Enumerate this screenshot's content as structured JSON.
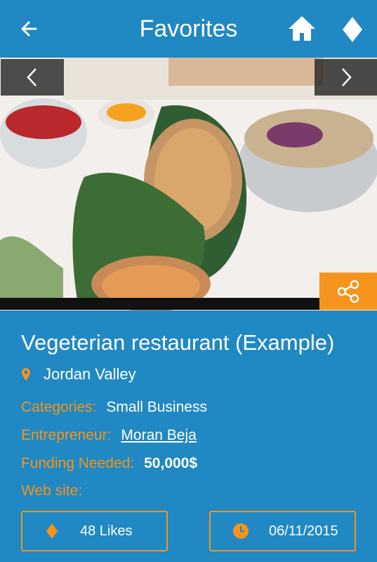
{
  "header": {
    "title": "Favorites"
  },
  "icons": {
    "back": "arrow-left-icon",
    "home": "home-icon",
    "favorite": "diamond-icon",
    "prev": "chevron-left-icon",
    "next": "chevron-right-icon",
    "share": "share-icon",
    "location": "location-pin-icon",
    "likes": "diamond-icon",
    "date": "clock-icon"
  },
  "colors": {
    "background": "#2088c2",
    "accent": "#f6941d",
    "text": "#ffffff"
  },
  "listing": {
    "name": "Vegeterian restaurant (Example)",
    "location": "Jordan Valley",
    "categories_label": "Categories:",
    "categories_value": "Small Business",
    "entrepreneur_label": "Entrepreneur:",
    "entrepreneur_value": "Moran Beja",
    "funding_label": "Funding Needed:",
    "funding_value": "50,000$",
    "website_label": "Web site:"
  },
  "stats": {
    "likes": "48 Likes",
    "date": "06/11/2015"
  }
}
